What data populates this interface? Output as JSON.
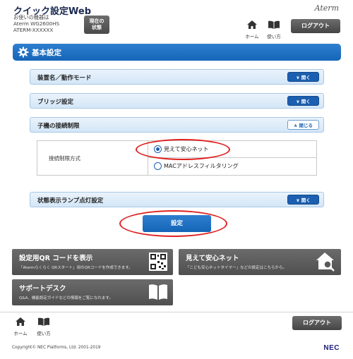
{
  "header": {
    "title": "クイック設定Web",
    "device_lines": [
      "お使いの機器は",
      "Aterm WG2600HS",
      "ATERM-XXXXXX"
    ],
    "status_button": [
      "現在の",
      "状態"
    ],
    "brand": "Aterm",
    "nav": [
      {
        "label": "ホーム",
        "icon": "home-icon"
      },
      {
        "label": "使い方",
        "icon": "book-icon"
      }
    ],
    "logout_label": "ログアウト"
  },
  "section": {
    "title": "基本設定",
    "icon": "gear-icon"
  },
  "accordions": [
    {
      "label": "装置名／動作モード",
      "toggle": "開く",
      "state": "collapsed"
    },
    {
      "label": "ブリッジ設定",
      "toggle": "開く",
      "state": "collapsed"
    },
    {
      "label": "子機の接続制限",
      "toggle": "閉じる",
      "state": "expanded"
    },
    {
      "label": "状態表示ランプ点灯設定",
      "toggle": "開く",
      "state": "collapsed"
    }
  ],
  "connection_restriction": {
    "field_label": "接続制限方式",
    "options": [
      {
        "label": "見えて安心ネット",
        "selected": true
      },
      {
        "label": "MACアドレスフィルタリング",
        "selected": false
      }
    ]
  },
  "apply_label": "設定",
  "tiles": [
    {
      "title": "設定用QR コードを表示",
      "desc": "「Atermらくらく QRスタート」用のQRコードを作成できます。",
      "icon": "qr-code-icon"
    },
    {
      "title": "見えて安心ネット",
      "desc": "「こども安心ネットタイマー」などの設定はこちらから。",
      "icon": "home-search-icon"
    },
    {
      "title": "サポートデスク",
      "desc": "Q&A、機能設定ガイドなどの情報をご覧になれます。",
      "icon": "book-icon"
    }
  ],
  "footer": {
    "nav": [
      {
        "label": "ホーム",
        "icon": "home-icon"
      },
      {
        "label": "使い方",
        "icon": "book-icon"
      }
    ],
    "logout_label": "ログアウト",
    "copyright": "Copyright© NEC Platforms, Ltd. 2001-2019",
    "logo": "NEC"
  },
  "colors": {
    "primary_blue": "#1565b8",
    "highlight_red": "#e02020",
    "tile_gray": "#5a5a5a"
  }
}
